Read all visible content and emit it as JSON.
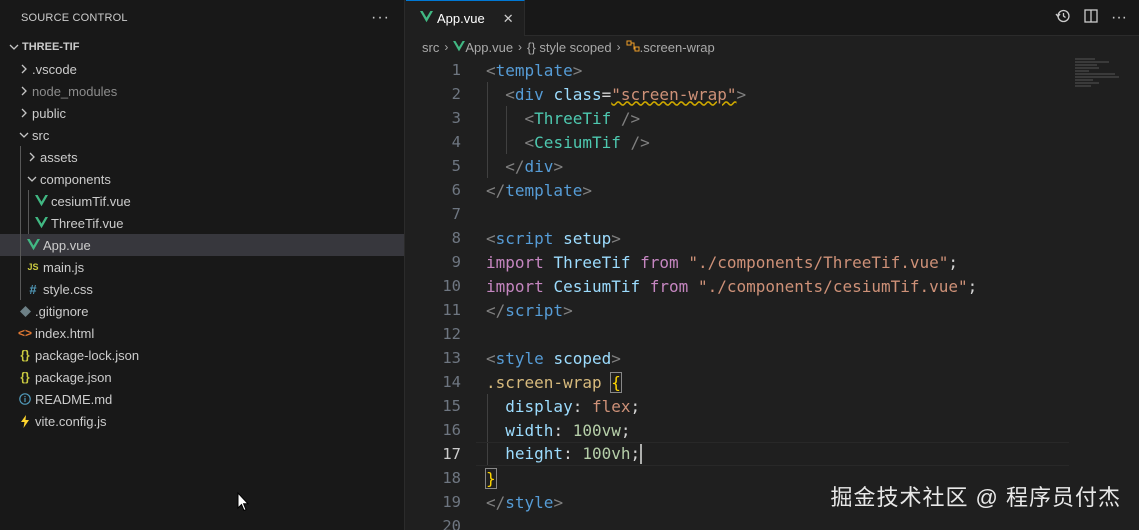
{
  "sidebar": {
    "title": "SOURCE CONTROL",
    "more": "···",
    "tree": [
      {
        "label": "THREE-TIF",
        "kind": "root"
      },
      {
        "label": ".vscode",
        "kind": "folder-closed"
      },
      {
        "label": "node_modules",
        "kind": "folder-closed",
        "dim": true
      },
      {
        "label": "public",
        "kind": "folder-closed"
      },
      {
        "label": "src",
        "kind": "folder-open"
      },
      {
        "label": "assets",
        "kind": "folder-closed"
      },
      {
        "label": "components",
        "kind": "folder-open"
      },
      {
        "label": "cesiumTif.vue",
        "kind": "vue"
      },
      {
        "label": "ThreeTif.vue",
        "kind": "vue"
      },
      {
        "label": "App.vue",
        "kind": "vue",
        "selected": true
      },
      {
        "label": "main.js",
        "kind": "js"
      },
      {
        "label": "style.css",
        "kind": "css"
      },
      {
        "label": ".gitignore",
        "kind": "git"
      },
      {
        "label": "index.html",
        "kind": "html"
      },
      {
        "label": "package-lock.json",
        "kind": "json"
      },
      {
        "label": "package.json",
        "kind": "json"
      },
      {
        "label": "README.md",
        "kind": "info"
      },
      {
        "label": "vite.config.js",
        "kind": "vite"
      }
    ]
  },
  "editor": {
    "tab": {
      "label": "App.vue",
      "close": "✕"
    },
    "breadcrumb": {
      "src": "src",
      "file": "App.vue",
      "block": "{} style scoped",
      "selector": ".screen-wrap"
    },
    "active_line": 17,
    "lines": [
      "1",
      "2",
      "3",
      "4",
      "5",
      "6",
      "7",
      "8",
      "9",
      "10",
      "11",
      "12",
      "13",
      "14",
      "15",
      "16",
      "17",
      "18",
      "19",
      "20"
    ]
  },
  "code": {
    "l1_open": "<",
    "l1_name": "template",
    "l1_close": ">",
    "l2_open": "<",
    "l2_name": "div",
    "l2_attr": "class",
    "l2_eq": "=",
    "l2_val": "\"screen-wrap\"",
    "l2_close": ">",
    "l3_open": "<",
    "l3_name": "ThreeTif",
    "l3_close": " />",
    "l4_open": "<",
    "l4_name": "CesiumTif",
    "l4_close": " />",
    "l5_open": "</",
    "l5_name": "div",
    "l5_close": ">",
    "l6_open": "</",
    "l6_name": "template",
    "l6_close": ">",
    "l8_open": "<",
    "l8_name": "script",
    "l8_attr": "setup",
    "l8_close": ">",
    "l9_kw": "import",
    "l9_id": "ThreeTif",
    "l9_from": "from",
    "l9_str": "\"./components/ThreeTif.vue\"",
    "l9_end": ";",
    "l10_kw": "import",
    "l10_id": "CesiumTif",
    "l10_from": "from",
    "l10_str": "\"./components/cesiumTif.vue\"",
    "l10_end": ";",
    "l11_open": "</",
    "l11_name": "script",
    "l11_close": ">",
    "l13_open": "<",
    "l13_name": "style",
    "l13_attr": "scoped",
    "l13_close": ">",
    "l14_sel": ".screen-wrap",
    "l14_br": "{",
    "l15_prop": "display",
    "l15_colon": ": ",
    "l15_val": "flex",
    "l15_end": ";",
    "l16_prop": "width",
    "l16_colon": ": ",
    "l16_val": "100vw",
    "l16_end": ";",
    "l17_prop": "height",
    "l17_colon": ": ",
    "l17_val": "100vh",
    "l17_end": ";",
    "l18_br": "}",
    "l19_open": "</",
    "l19_name": "style",
    "l19_close": ">"
  },
  "watermark": "掘金技术社区 @ 程序员付杰",
  "colors": {
    "accent": "#0078d4",
    "vue": "#41b883",
    "js": "#cbcb41",
    "css": "#519aba",
    "json": "#cbcb41",
    "html": "#e37933",
    "vite": "#ffd62e"
  }
}
